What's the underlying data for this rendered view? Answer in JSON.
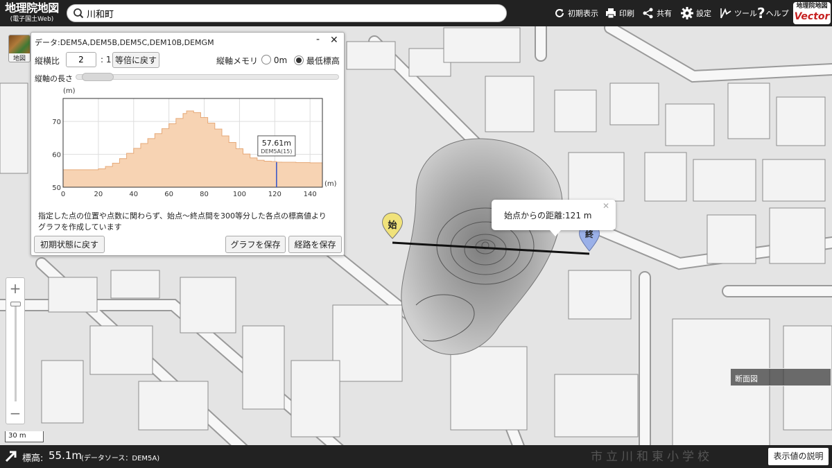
{
  "header": {
    "logo_line1": "地理院地図",
    "logo_line2": "(電子国土Web)",
    "search_value": "川和町",
    "buttons": {
      "initial_view": "初期表示",
      "print": "印刷",
      "share": "共有",
      "settings": "設定",
      "tools": "ツール",
      "help": "ヘルプ"
    },
    "vector_logo_line1": "地理院地図",
    "vector_logo_line2": "Vector"
  },
  "layer_button": {
    "label": "地図"
  },
  "panel": {
    "data_label": "データ:DEM5A,DEM5B,DEM5C,DEM10B,DEMGM",
    "ratio_label": "縦横比",
    "ratio_value": "2",
    "ratio_suffix": ": 1",
    "reset_ratio_button": "等倍に戻す",
    "axis_memory_label": "縦軸メモリ",
    "option_zero": "0m",
    "option_min": "最低標高",
    "axis_length_label": "縦軸の長さ",
    "note_line1": "指定した点の位置や点数に関わらず、始点～終点間を300等分した各点の標高値より",
    "note_line2": "グラフを作成しています",
    "reset_button": "初期状態に戻す",
    "save_graph_button": "グラフを保存",
    "save_route_button": "経路を保存"
  },
  "chart_data": {
    "type": "area",
    "ylabel": "(m)",
    "xlabel": "(m)",
    "ylim": [
      50,
      77
    ],
    "xlim": [
      0,
      147
    ],
    "x_ticks": [
      0,
      20,
      40,
      60,
      80,
      100,
      120,
      140
    ],
    "y_ticks": [
      50,
      60,
      70
    ],
    "x": [
      0,
      4,
      8,
      12,
      16,
      20,
      24,
      28,
      32,
      36,
      40,
      44,
      48,
      52,
      56,
      60,
      64,
      68,
      70,
      72,
      74,
      78,
      82,
      86,
      90,
      94,
      98,
      102,
      106,
      110,
      114,
      118,
      121,
      124,
      128,
      132,
      136,
      140,
      144,
      147
    ],
    "y": [
      55.3,
      55.3,
      55.3,
      55.3,
      55.3,
      55.6,
      56.3,
      57.3,
      58.7,
      60.3,
      61.8,
      63.3,
      64.8,
      66.3,
      67.8,
      69.3,
      70.9,
      72.4,
      73.2,
      73.2,
      72.7,
      71.2,
      69.5,
      67.7,
      65.6,
      63.6,
      61.7,
      60.1,
      58.9,
      58.2,
      57.9,
      57.8,
      57.61,
      57.6,
      57.6,
      57.5,
      57.5,
      57.4,
      57.4,
      57.4
    ],
    "marker": {
      "x": 121,
      "label": "57.61m",
      "sublabel": "DEM5A(15)"
    }
  },
  "map": {
    "start_label": "始",
    "end_label": "終",
    "distance_text": "始点からの距離:121 m",
    "scale_label": "30 m",
    "dansen_label": "断面図"
  },
  "footer": {
    "elev_label": "標高:",
    "elev_value": "55.1m",
    "elev_source": "(データソース：DEM5A)",
    "school_label": "市立川和東小学校",
    "explain_button": "表示値の説明"
  }
}
